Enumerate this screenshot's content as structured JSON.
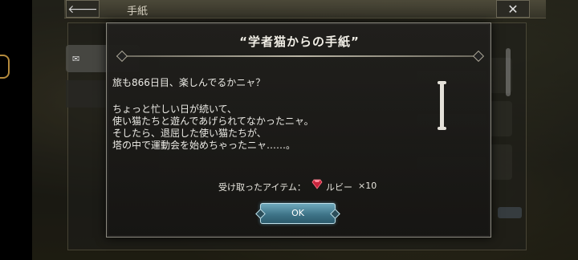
{
  "window": {
    "title": "手紙",
    "back_icon": "arrow-left-icon",
    "close_icon": "close-icon"
  },
  "dialog": {
    "title": "“学者猫からの手紙”",
    "paragraphs": [
      "旅も866日目、楽しんでるかニャ？",
      "ちょっと忙しい日が続いて、\n使い猫たちと遊んであげられてなかったニャ。\nそしたら、退屈した使い猫たちが、\n塔の中で運動会を始めちゃったニャ……。"
    ],
    "items_label": "受け取ったアイテム：",
    "item": {
      "icon": "ruby-icon",
      "name": "ルビー",
      "count": "×10"
    },
    "ok_label": "OK"
  },
  "colors": {
    "accent_ok": "#3f7488",
    "ruby": "#c8233c",
    "frame": "#8c8a80"
  }
}
